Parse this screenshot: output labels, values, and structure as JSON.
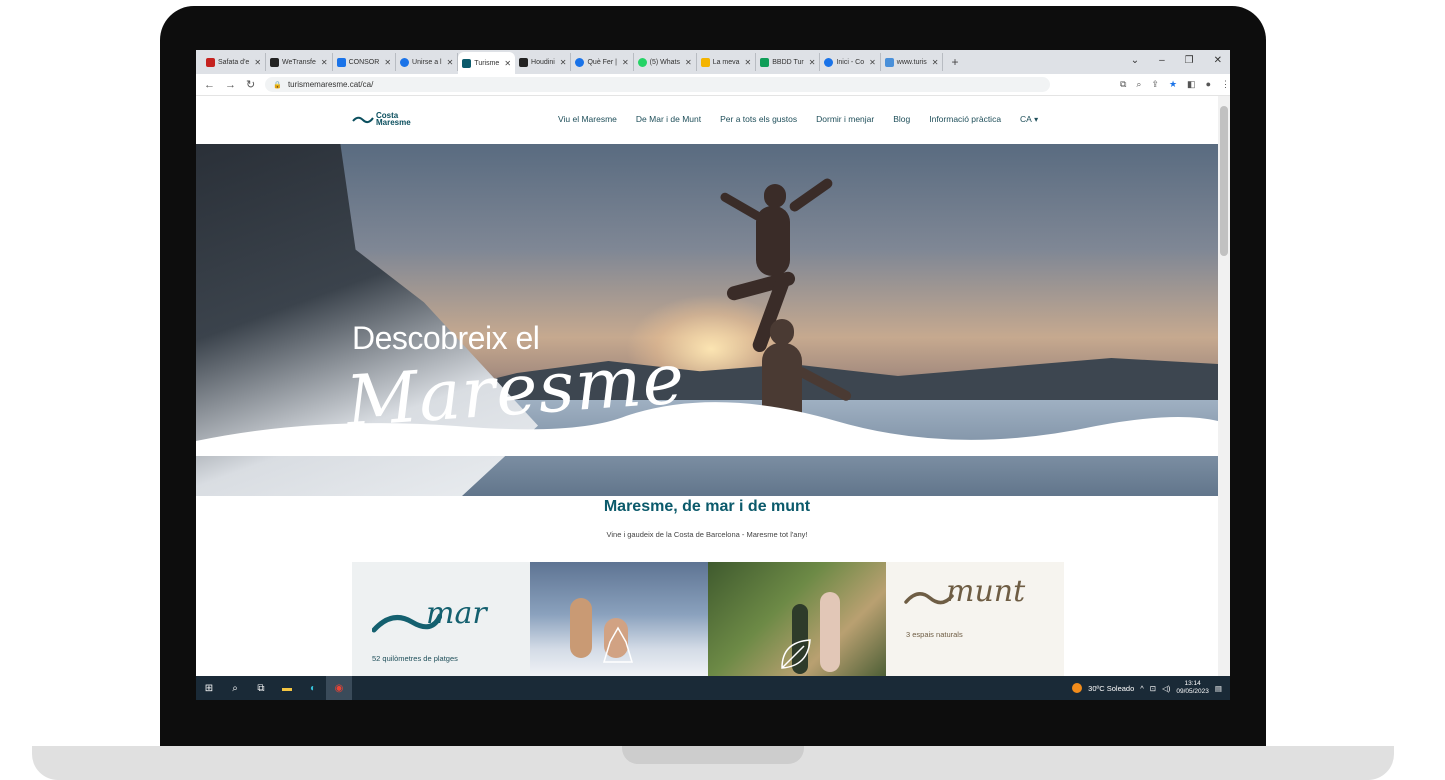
{
  "browser": {
    "tabs": [
      {
        "label": "Safata d'e",
        "icon": "gmail-icon",
        "color": "#c5221f"
      },
      {
        "label": "WeTransfe",
        "icon": "wetransfer-icon",
        "color": "#222222"
      },
      {
        "label": "CONSOR",
        "icon": "consorci-icon",
        "color": "#1a73e8"
      },
      {
        "label": "Unirse a l",
        "icon": "skype-icon",
        "color": "#1a73e8"
      },
      {
        "label": "Turisme",
        "icon": "costa-maresme-icon",
        "color": "#0b5a6b",
        "active": true
      },
      {
        "label": "Houdini",
        "icon": "houdini-icon",
        "color": "#222222"
      },
      {
        "label": "Què Fer |",
        "icon": "quefer-icon",
        "color": "#1a73e8"
      },
      {
        "label": "(5) Whats",
        "icon": "whatsapp-icon",
        "color": "#25d366"
      },
      {
        "label": "La meva",
        "icon": "drive-icon",
        "color": "#f4b400"
      },
      {
        "label": "BBDD Tur",
        "icon": "sheets-icon",
        "color": "#0f9d58"
      },
      {
        "label": "Inici - Co",
        "icon": "chrome-icon",
        "color": "#1a73e8"
      },
      {
        "label": "www.turis",
        "icon": "site-icon",
        "color": "#4a90d9"
      }
    ],
    "url": "turismemaresme.cat/ca/"
  },
  "site": {
    "logo_line1": "Costa",
    "logo_line2": "Maresme",
    "menu": [
      "Viu el Maresme",
      "De Mar i de Munt",
      "Per a tots els gustos",
      "Dormir i menjar",
      "Blog",
      "Informació pràctica"
    ],
    "lang": "CA",
    "hero_line1": "Descobreix el",
    "hero_line2": "Maresme",
    "section_title": "Maresme, de mar i de munt",
    "section_subtitle": "Vine i gaudeix de la Costa de Barcelona - Maresme tot l'any!",
    "cards": [
      {
        "script": "mar",
        "label": "52 quilòmetres de platges"
      },
      {
        "script": "",
        "label": ""
      },
      {
        "script": "",
        "label": ""
      },
      {
        "script": "munt",
        "label": "3 espais naturals"
      }
    ]
  },
  "taskbar": {
    "weather": "30ºC Soleado",
    "time": "13:14",
    "date": "09/05/2023"
  }
}
